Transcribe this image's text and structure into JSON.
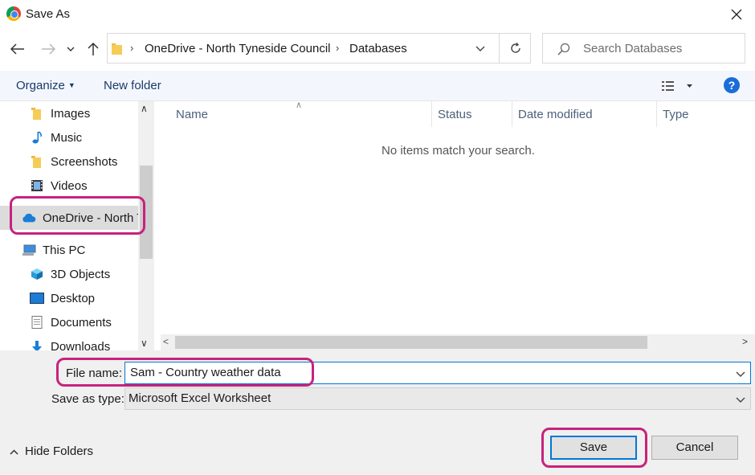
{
  "window": {
    "title": "Save As"
  },
  "address": {
    "segments": [
      "OneDrive - North Tyneside Council",
      "Databases"
    ]
  },
  "search": {
    "placeholder": "Search Databases"
  },
  "toolbar": {
    "organize_label": "Organize",
    "new_folder_label": "New folder",
    "help_label": "?"
  },
  "sidebar": {
    "items": [
      {
        "label": "Images",
        "icon": "folder-icon"
      },
      {
        "label": "Music",
        "icon": "music-note-icon"
      },
      {
        "label": "Screenshots",
        "icon": "folder-icon"
      },
      {
        "label": "Videos",
        "icon": "film-icon"
      },
      {
        "label": "OneDrive - North Tyneside Council",
        "icon": "cloud-icon",
        "selected": true
      },
      {
        "label": "This PC",
        "icon": "computer-icon"
      },
      {
        "label": "3D Objects",
        "icon": "cube-icon"
      },
      {
        "label": "Desktop",
        "icon": "desktop-icon"
      },
      {
        "label": "Documents",
        "icon": "document-icon"
      },
      {
        "label": "Downloads",
        "icon": "download-arrow-icon"
      }
    ]
  },
  "filelist": {
    "columns": [
      "Name",
      "Status",
      "Date modified",
      "Type"
    ],
    "empty_message": "No items match your search."
  },
  "form": {
    "filename_label": "File name:",
    "filename_value": "Sam - Country weather data",
    "type_label": "Save as type:",
    "type_value": "Microsoft Excel Worksheet"
  },
  "footer": {
    "hide_folders_label": "Hide Folders",
    "save_label": "Save",
    "cancel_label": "Cancel"
  },
  "colors": {
    "accent": "#0078d7",
    "annotation": "#c8227d",
    "toolbar_bg": "#f3f6fc",
    "bottom_bg": "#f0f0f0"
  }
}
